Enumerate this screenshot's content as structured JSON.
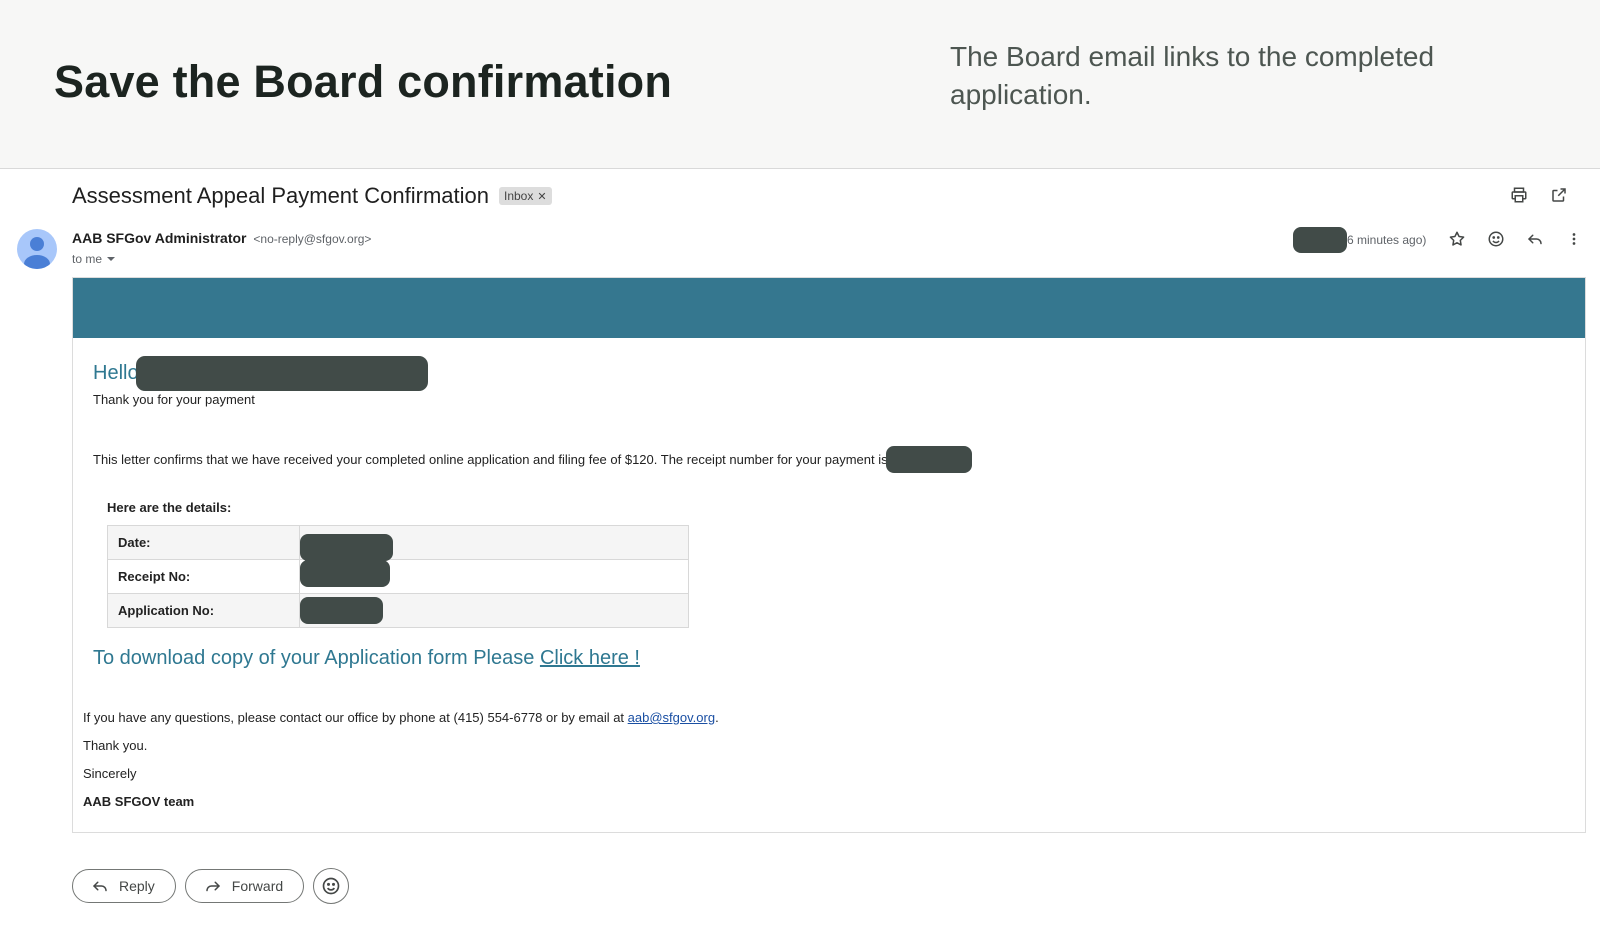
{
  "banner": {
    "title": "Save the Board confirmation",
    "description": "The Board email links to the completed application."
  },
  "email": {
    "subject": "Assessment Appeal Payment Confirmation",
    "label": "Inbox",
    "sender_name": "AAB SFGov Administrator",
    "sender_email": "<no-reply@sfgov.org>",
    "recipient": "to me",
    "time_suffix": "6 minutes ago)",
    "header_icons": [
      "print-icon",
      "open-in-new-window-icon"
    ],
    "meta_icons": [
      "star-icon",
      "emoji-icon",
      "reply-icon",
      "more-vert-icon"
    ]
  },
  "body": {
    "greeting": "Hello",
    "thanks_payment": "Thank you for your payment",
    "letter": "This letter confirms that we have received your completed online application and filing fee of $120. The receipt number for your payment is",
    "details_heading": "Here are the details:",
    "details": [
      {
        "label": "Date:"
      },
      {
        "label": "Receipt No:"
      },
      {
        "label": "Application No:"
      }
    ],
    "download_text": "To download copy of your Application form Please ",
    "download_link": "Click here !",
    "contact_text": "If you have any questions, please contact our office by phone at (415) 554-6778 or by email at ",
    "contact_email": "aab@sfgov.org",
    "contact_end": ".",
    "thank_you": "Thank you.",
    "sincerely": "Sincerely",
    "team": "AAB SFGOV team",
    "header_bar_color": "#35778f",
    "accent_text_color": "#2f7891"
  },
  "actions": {
    "reply": "Reply",
    "forward": "Forward"
  }
}
